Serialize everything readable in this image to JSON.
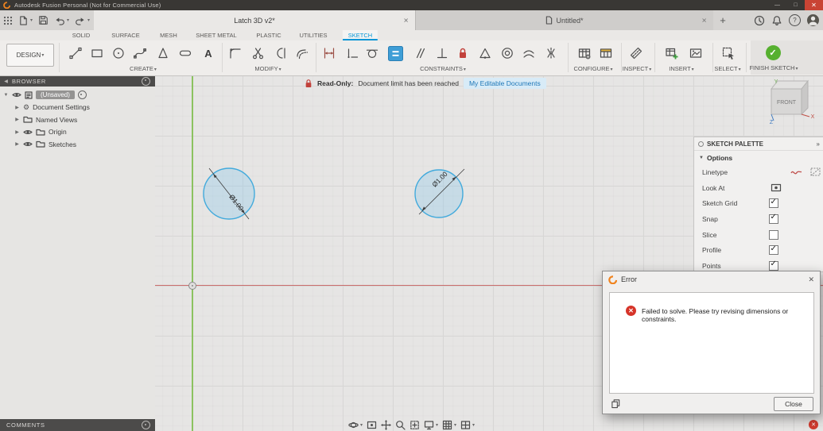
{
  "colors": {
    "accent_blue": "#0696d7",
    "active_tool_blue": "#3f9ed6",
    "finish_green": "#56b02f",
    "error_red": "#d63429",
    "axis_x_red": "#c44f4d",
    "axis_y_green": "#7cbd4a",
    "link_blue": "#1f78b8"
  },
  "title_bar": {
    "title": "Autodesk Fusion Personal (Not for Commercial Use)",
    "minimize_glyph": "—",
    "maximize_glyph": "□",
    "close_glyph": "✕"
  },
  "quick_access": {
    "icons": [
      "app-grid",
      "file",
      "save",
      "undo",
      "redo"
    ]
  },
  "document_tabs": {
    "tabs": [
      {
        "label": "Latch 3D v2*"
      },
      {
        "label": "Untitled*"
      }
    ],
    "new_tab_glyph": "+",
    "close_glyph": "✕"
  },
  "top_right": {
    "icons": [
      "job-status",
      "notifications",
      "help",
      "profile"
    ],
    "help_glyph": "?"
  },
  "toolbar": {
    "design_menu": "DESIGN",
    "tabs": [
      "SOLID",
      "SURFACE",
      "MESH",
      "SHEET METAL",
      "PLASTIC",
      "UTILITIES",
      "SKETCH"
    ],
    "active_tab": "SKETCH",
    "groups": [
      {
        "label": "CREATE",
        "tools": [
          "line",
          "rectangle",
          "circle",
          "spline",
          "polygon",
          "slot",
          "text"
        ]
      },
      {
        "label": "MODIFY",
        "tools": [
          "fillet",
          "trim",
          "extend",
          "offset"
        ]
      },
      {
        "label": "CONSTRAINTS",
        "tools": [
          "sketch-dimension",
          "horizontal-vertical",
          "tangent",
          "equal",
          "parallel",
          "perpendicular",
          "fix",
          "midpoint",
          "concentric",
          "curvature",
          "symmetry"
        ],
        "active_tool": "equal"
      },
      {
        "label": "CONFIGURE",
        "tools": [
          "configure",
          "configuration-table"
        ]
      },
      {
        "label": "INSPECT",
        "tools": [
          "measure"
        ]
      },
      {
        "label": "INSERT",
        "tools": [
          "insert-table",
          "canvas"
        ]
      },
      {
        "label": "SELECT",
        "tools": [
          "select"
        ]
      },
      {
        "label": "FINISH SKETCH",
        "tools": [
          "finish-sketch"
        ],
        "check_glyph": "✓"
      }
    ]
  },
  "readonly_banner": {
    "label": "Read-Only:",
    "message": "Document limit has been reached",
    "link_label": "My Editable Documents"
  },
  "browser": {
    "header": "BROWSER",
    "root_label": "(Unsaved)",
    "items": [
      {
        "label": "Document Settings"
      },
      {
        "label": "Named Views"
      },
      {
        "label": "Origin"
      },
      {
        "label": "Sketches"
      }
    ]
  },
  "view_cube": {
    "face_label": "FRONT",
    "axis_labels": {
      "x": "X",
      "y": "Y",
      "z": "Z"
    }
  },
  "sketch_palette": {
    "header": "SKETCH PALETTE",
    "collapse_glyph": "»",
    "section_label": "Options",
    "rows": [
      {
        "label": "Linetype",
        "control": "linetype-buttons"
      },
      {
        "label": "Look At",
        "control": "look-at-button"
      },
      {
        "label": "Sketch Grid",
        "control": "checkbox",
        "checked": true
      },
      {
        "label": "Snap",
        "control": "checkbox",
        "checked": true
      },
      {
        "label": "Slice",
        "control": "checkbox",
        "checked": false
      },
      {
        "label": "Profile",
        "control": "checkbox",
        "checked": true
      },
      {
        "label": "Points",
        "control": "checkbox",
        "checked": true
      }
    ]
  },
  "sketch": {
    "circles": [
      {
        "dimension": "Ø1.00"
      },
      {
        "dimension": "Ø1.00"
      }
    ]
  },
  "error_dialog": {
    "title": "Error",
    "message": "Failed to solve. Please try revising dimensions or constraints.",
    "close_label": "Close",
    "close_glyph": "✕"
  },
  "comments_panel": {
    "header": "COMMENTS"
  },
  "nav_bar": {
    "icons": [
      "orbit",
      "look-at",
      "pan",
      "zoom",
      "fit",
      "display-settings",
      "grid-settings",
      "viewports"
    ]
  }
}
